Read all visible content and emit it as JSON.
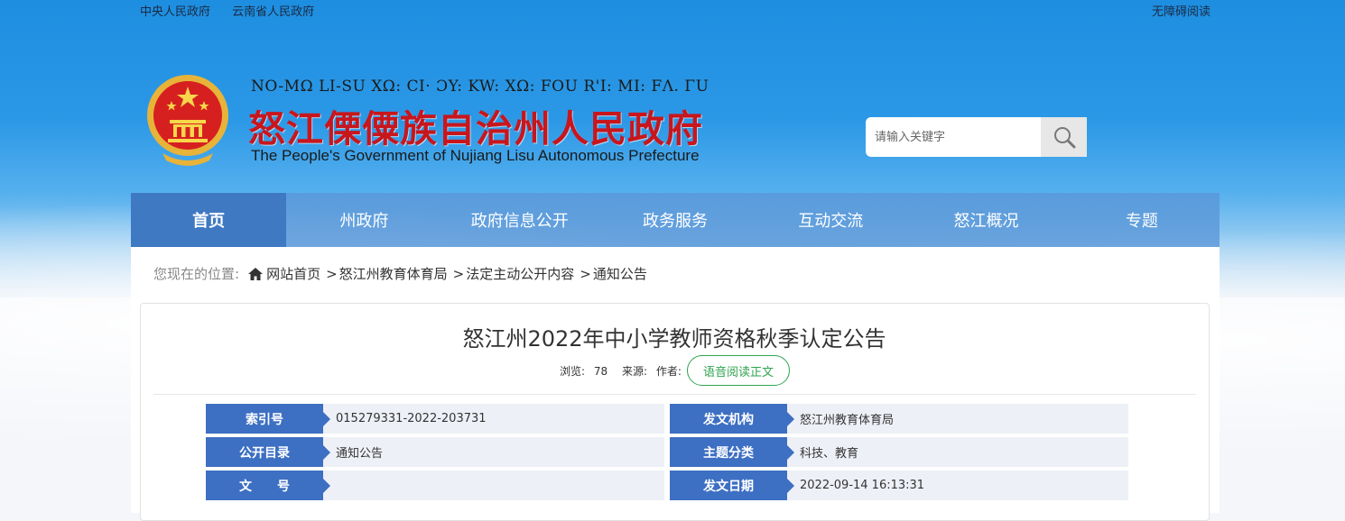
{
  "top_links": [
    "中央人民政府",
    "云南省人民政府"
  ],
  "accessibility_link": "无障碍阅读",
  "brand": {
    "latin_name": "NO-MΩ LI-SU XΩ: CI· ƆY: KW: XΩ: FOU R'I: MI: FɅ. ΓU",
    "chinese_name": "怒江傈僳族自治州人民政府",
    "english_name": "The People's Government of Nujiang Lisu Autonomous Prefecture"
  },
  "search": {
    "placeholder": "请输入关键字",
    "icon": "search-icon"
  },
  "nav": {
    "items": [
      "首页",
      "州政府",
      "政府信息公开",
      "政务服务",
      "互动交流",
      "怒江概况",
      "专题"
    ],
    "active_index": 0
  },
  "breadcrumb": {
    "prefix": "您现在的位置:",
    "home": "网站首页",
    "items": [
      "怒江州教育体育局",
      "法定主动公开内容",
      "通知公告"
    ],
    "separator": ">"
  },
  "article": {
    "title": "怒江州2022年中小学教师资格秋季认定公告",
    "views_label": "浏览:",
    "views": "78",
    "source_label": "来源:",
    "author_label": "作者:",
    "tts_button": "语音阅读正文"
  },
  "info": {
    "rows": [
      [
        {
          "label": "索引号",
          "value": "015279331-2022-203731"
        },
        {
          "label": "发文机构",
          "value": "怒江州教育体育局"
        }
      ],
      [
        {
          "label": "公开目录",
          "value": "通知公告"
        },
        {
          "label": "主题分类",
          "value": "科技、教育"
        }
      ],
      [
        {
          "label": "文　　号",
          "value": ""
        },
        {
          "label": "发文日期",
          "value": "2022-09-14 16:13:31"
        }
      ]
    ]
  },
  "colors": {
    "nav_active": "#3e79c2",
    "label_bg": "#3d6fc3",
    "brand_red": "#c8161d",
    "tts_green": "#2fa44f"
  }
}
